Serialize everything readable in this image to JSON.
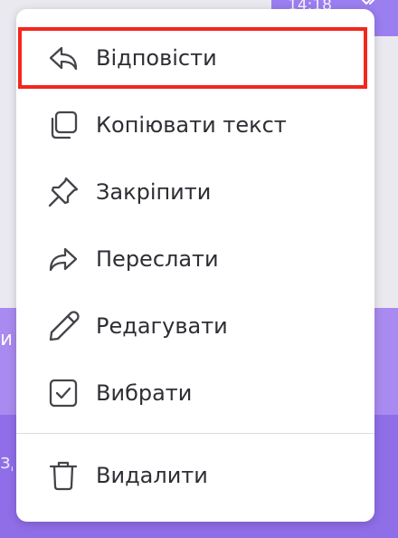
{
  "status": {
    "time": "14:18"
  },
  "menu": {
    "items": [
      {
        "label": "Відповісти",
        "icon": "reply-icon"
      },
      {
        "label": "Копіювати текст",
        "icon": "copy-icon"
      },
      {
        "label": "Закріпити",
        "icon": "pin-icon"
      },
      {
        "label": "Переслати",
        "icon": "forward-icon"
      },
      {
        "label": "Редагувати",
        "icon": "pencil-icon"
      },
      {
        "label": "Вибрати",
        "icon": "checkbox-icon"
      },
      {
        "label": "Видалити",
        "icon": "trash-icon"
      }
    ],
    "highlight_color": "#f2271d"
  },
  "colors": {
    "accent": "#9b7ef0",
    "menu_bg": "#ffffff",
    "text": "#2e2f35",
    "icon": "#44454b"
  }
}
